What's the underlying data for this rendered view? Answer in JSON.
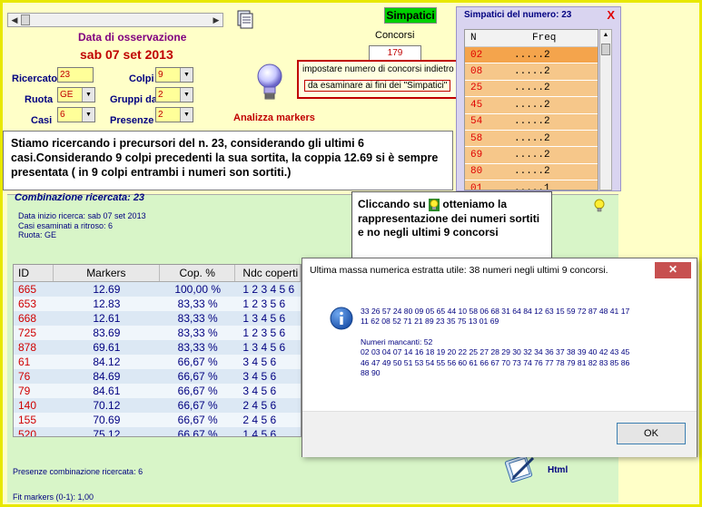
{
  "date": {
    "label": "Data di osservazione",
    "value": "sab 07 set 2013"
  },
  "fields": {
    "ricercato": {
      "label": "Ricercato",
      "value": "23"
    },
    "colpi": {
      "label": "Colpi",
      "value": "9"
    },
    "ruota": {
      "label": "Ruota",
      "value": "GE"
    },
    "gruppi_da": {
      "label": "Gruppi da",
      "value": "2"
    },
    "casi": {
      "label": "Casi",
      "value": "6"
    },
    "presenze": {
      "label": "Presenze",
      "value": "2"
    }
  },
  "analizza_label": "Analizza markers",
  "simpatici_button": "Simpatici",
  "concorsi": {
    "label": "Concorsi",
    "value": "179"
  },
  "tooltip": {
    "line1": "impostare numero di concorsi indietro",
    "line2": "da esaminare ai fini dei \"Simpatici\""
  },
  "panel": {
    "title": "Simpatici del numero: 23",
    "close": "X",
    "headers": [
      "N",
      "Freq"
    ],
    "rows": [
      {
        "n": "02",
        "freq": ".....2"
      },
      {
        "n": "08",
        "freq": ".....2"
      },
      {
        "n": "25",
        "freq": ".....2"
      },
      {
        "n": "45",
        "freq": ".....2"
      },
      {
        "n": "54",
        "freq": ".....2"
      },
      {
        "n": "58",
        "freq": ".....2"
      },
      {
        "n": "69",
        "freq": ".....2"
      },
      {
        "n": "80",
        "freq": ".....2"
      },
      {
        "n": "01",
        "freq": ".....1"
      }
    ]
  },
  "info_text": "Stiamo ricercando i precursori del n. 23, considerando gli ultimi 6 casi.Considerando 9 colpi precedenti la sua sortita, la coppia 12.69 si è sempre presentata ( in 9 colpi entrambi i numeri son sortiti.)",
  "combination": {
    "title": "Combinazione ricercata: 23",
    "line1": "Data inizio ricerca: sab 07 set 2013",
    "line2": "Casi esaminati a ritroso: 6",
    "line3": "Ruota: GE",
    "headers": [
      "ID",
      "Markers",
      "Cop. %",
      "Ndc coperti"
    ],
    "rows": [
      {
        "id": "665",
        "markers": "12.69",
        "cop": "100,00 %",
        "ndc": "1 2 3 4 5 6"
      },
      {
        "id": "653",
        "markers": "12.83",
        "cop": "83,33 %",
        "ndc": "1 2 3 5 6"
      },
      {
        "id": "668",
        "markers": "12.61",
        "cop": "83,33 %",
        "ndc": "1 3 4 5 6"
      },
      {
        "id": "725",
        "markers": "83.69",
        "cop": "83,33 %",
        "ndc": "1 2 3 5 6"
      },
      {
        "id": "878",
        "markers": "69.61",
        "cop": "83,33 %",
        "ndc": "1 3 4 5 6"
      },
      {
        "id": "61",
        "markers": "84.12",
        "cop": "66,67 %",
        "ndc": "3 4 5 6"
      },
      {
        "id": "76",
        "markers": "84.69",
        "cop": "66,67 %",
        "ndc": "3 4 5 6"
      },
      {
        "id": "79",
        "markers": "84.61",
        "cop": "66,67 %",
        "ndc": "3 4 5 6"
      },
      {
        "id": "140",
        "markers": "70.12",
        "cop": "66,67 %",
        "ndc": "2 4 5 6"
      },
      {
        "id": "155",
        "markers": "70.69",
        "cop": "66,67 %",
        "ndc": "2 4 5 6"
      },
      {
        "id": "520",
        "markers": "75.12",
        "cop": "66,67 %",
        "ndc": "1 4 5 6"
      }
    ],
    "presenze": "Presenze combinazione ricercata: 6",
    "fit": "Fit markers (0-1): 1,00"
  },
  "callout": {
    "before": "Cliccando su",
    "after": "otteniamo la rappresentazione dei numeri sortiti e no negli ultimi 9 concorsi"
  },
  "html_label": "Html",
  "dialog": {
    "title": "Ultima massa numerica estratta utile: 38 numeri negli ultimi 9 concorsi.",
    "close": "✕",
    "numbers_line1": "33 26 57 24 80 09 05 65 44 10 58 06 68 31 64 84 12 63 15 59 72 87 48 41 17",
    "numbers_line2": "11 62 08 52 71 21 89 23 35 75 13 01 69",
    "missing_title": "Numeri mancanti: 52",
    "missing_line1": "02 03 04 07 14 16 18 19 20 22 25 27 28 29 30 32 34 36 37 38 39 40 42 43 45",
    "missing_line2": "46 47 49 50 51 53 54 55 56 60 61 66 67 70 73 74 76 77 78 79 81 82 83 85 86",
    "missing_line3": "88 90",
    "ok": "OK"
  }
}
